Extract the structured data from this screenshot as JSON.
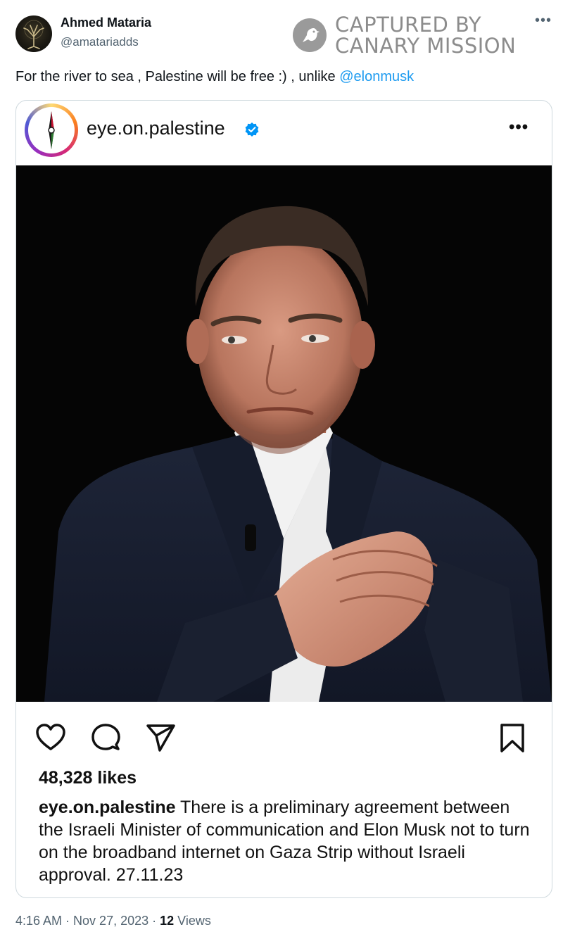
{
  "tweet": {
    "author_name": "Ahmed Mataria",
    "author_handle": "@amatariadds",
    "text": "For the river to sea , Palestine will be free :) , unlike ",
    "mention": "@elonmusk",
    "more_icon": "more-horizontal-icon",
    "time": "4:16 AM",
    "separator": " · ",
    "date": "Nov 27, 2023",
    "views_count": "12",
    "views_label": " Views"
  },
  "watermark": {
    "line1": "CAPTURED BY",
    "line2": "CANARY MISSION",
    "icon": "canary-bird-icon"
  },
  "embed": {
    "username": "eye.on.palestine",
    "verified_icon": "verified-badge-icon",
    "more_icon": "more-horizontal-icon",
    "photo_icon": "portrait-photo",
    "actions": [
      "heart-icon",
      "comment-icon",
      "share-icon",
      "bookmark-icon"
    ],
    "likes": "48,328 likes",
    "caption_user": "eye.on.palestine",
    "caption_text": " There is a preliminary agreement between the Israeli Minister of communication and Elon Musk not to turn on the broadband internet on Gaza Strip without Israeli approval. 27.11.23"
  },
  "colors": {
    "mention": "#1d9bf0",
    "secondary_text": "#536471",
    "verified": "#0095f6",
    "photo_background": "#050505",
    "watermark": "#8c8c8c"
  }
}
